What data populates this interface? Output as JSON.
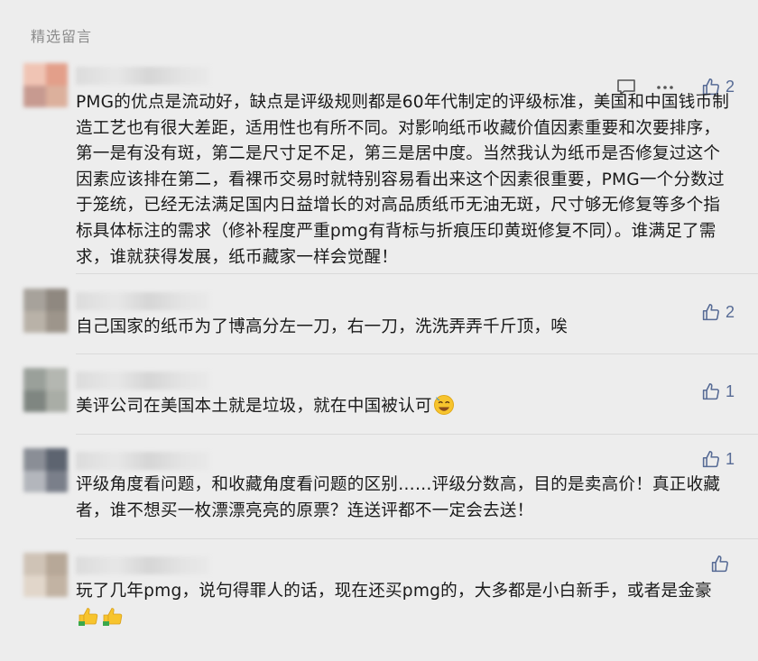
{
  "section_title": "精选留言",
  "comments": [
    {
      "likes": "2",
      "text": "PMG的优点是流动好，缺点是评级规则都是60年代制定的评级标准，美国和中国钱币制造工艺也有很大差距，适用性也有所不同。对影响纸币收藏价值因素重要和次要排序，第一是有没有斑，第二是尺寸足不足，第三是居中度。当然我认为纸币是否修复过这个因素应该排在第二，看裸币交易时就特别容易看出来这个因素很重要，PMG一个分数过于笼统，已经无法满足国内日益增长的对高品质纸币无油无斑，尺寸够无修复等多个指标具体标注的需求（修补程度严重pmg有背标与折痕压印黄斑修复不同）。谁满足了需求，谁就获得发展，纸币藏家一样会觉醒！",
      "avatar_colors": [
        "#f0c4b4",
        "#e39f8a",
        "#c79a90",
        "#dcb09c"
      ]
    },
    {
      "likes": "2",
      "text": "自己国家的纸币为了博高分左一刀，右一刀，洗洗弄弄千斤顶，唉",
      "avatar_colors": [
        "#a7a29b",
        "#8f8880",
        "#b9b2a8",
        "#9d958b"
      ]
    },
    {
      "likes": "1",
      "text": "美评公司在美国本土就是垃圾，就在中国被认可",
      "emoji": "sweat-smile-emoji",
      "avatar_colors": [
        "#9aa09a",
        "#b4b7b1",
        "#7f8681",
        "#a9ada6"
      ]
    },
    {
      "likes": "1",
      "text": "评级角度看问题，和收藏角度看问题的区别……评级分数高，目的是卖高价！真正收藏者，谁不想买一枚漂漂亮亮的原票？连送评都不一定会去送！",
      "avatar_colors": [
        "#8a8e96",
        "#5d6470",
        "#b3b6bc",
        "#7a7f8a"
      ]
    },
    {
      "likes": "",
      "text": "玩了几年pmg，说句得罪人的话，现在还买pmg的，大多都是小白新手，或者是金豪",
      "emoji": "thumbs-up-emoji-x2",
      "avatar_colors": [
        "#cfc3b6",
        "#b7a898",
        "#e1d6ca",
        "#c2b3a3"
      ]
    }
  ],
  "colors": {
    "link_blue": "#576b95",
    "background": "#ededed",
    "text": "#1a1a1a",
    "muted": "#8c8c8c"
  }
}
